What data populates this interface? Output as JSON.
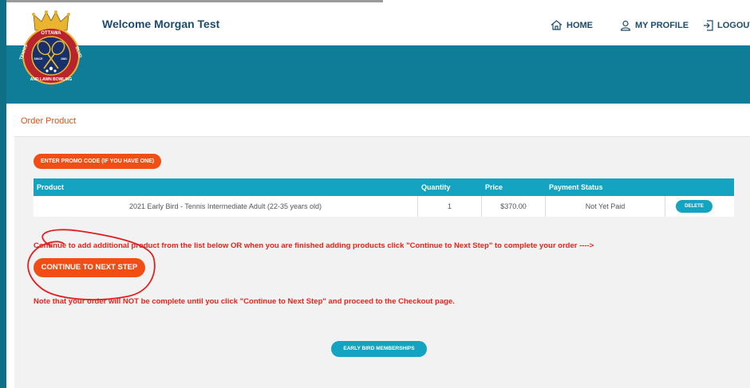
{
  "header": {
    "welcome": "Welcome Morgan Test",
    "nav": {
      "home": "HOME",
      "profile": "MY PROFILE",
      "logout": "LOGOUT"
    }
  },
  "logo": {
    "top_text": "OTTAWA",
    "left_text": "TENNIS",
    "right_text": "BLVD",
    "since": "SINCE",
    "year": "1881",
    "bottom_text": "AND LAWN BOWLING"
  },
  "order": {
    "title": "Order Product",
    "promo_label": "ENTER PROMO CODE (IF YOU HAVE ONE)",
    "table": {
      "headers": {
        "product": "Product",
        "quantity": "Quantity",
        "price": "Price",
        "status": "Payment Status"
      },
      "rows": [
        {
          "product": "2021 Early Bird - Tennis Intermediate Adult (22-35 years old)",
          "quantity": "1",
          "price": "$370.00",
          "status": "Not Yet Paid",
          "delete_label": "DELETE"
        }
      ]
    },
    "instruction": "Continue to add additional product from the list below OR when you are finished adding products click \"Continue to Next Step\" to complete your order ---->",
    "continue_label": "CONTINUE TO NEXT STEP",
    "note": "Note that your order will NOT be complete until you click \"Continue to Next Step\" and proceed to the Checkout page.",
    "early_bird_label": "EARLY BIRD MEMBERSHIPS"
  },
  "colors": {
    "accent_orange": "#f04e14",
    "teal": "#0f7d97",
    "table_header": "#15a3c2",
    "warning_red": "#e8231a",
    "annotation_red": "#e02020"
  }
}
